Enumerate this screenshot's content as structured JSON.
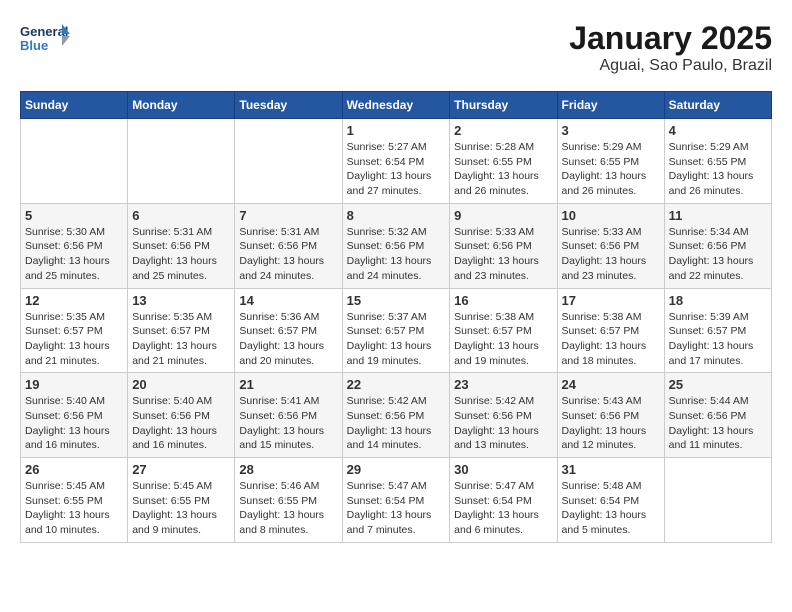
{
  "header": {
    "logo_line1": "General",
    "logo_line2": "Blue",
    "month": "January 2025",
    "location": "Aguai, Sao Paulo, Brazil"
  },
  "weekdays": [
    "Sunday",
    "Monday",
    "Tuesday",
    "Wednesday",
    "Thursday",
    "Friday",
    "Saturday"
  ],
  "weeks": [
    [
      {
        "day": "",
        "info": ""
      },
      {
        "day": "",
        "info": ""
      },
      {
        "day": "",
        "info": ""
      },
      {
        "day": "1",
        "info": "Sunrise: 5:27 AM\nSunset: 6:54 PM\nDaylight: 13 hours\nand 27 minutes."
      },
      {
        "day": "2",
        "info": "Sunrise: 5:28 AM\nSunset: 6:55 PM\nDaylight: 13 hours\nand 26 minutes."
      },
      {
        "day": "3",
        "info": "Sunrise: 5:29 AM\nSunset: 6:55 PM\nDaylight: 13 hours\nand 26 minutes."
      },
      {
        "day": "4",
        "info": "Sunrise: 5:29 AM\nSunset: 6:55 PM\nDaylight: 13 hours\nand 26 minutes."
      }
    ],
    [
      {
        "day": "5",
        "info": "Sunrise: 5:30 AM\nSunset: 6:56 PM\nDaylight: 13 hours\nand 25 minutes."
      },
      {
        "day": "6",
        "info": "Sunrise: 5:31 AM\nSunset: 6:56 PM\nDaylight: 13 hours\nand 25 minutes."
      },
      {
        "day": "7",
        "info": "Sunrise: 5:31 AM\nSunset: 6:56 PM\nDaylight: 13 hours\nand 24 minutes."
      },
      {
        "day": "8",
        "info": "Sunrise: 5:32 AM\nSunset: 6:56 PM\nDaylight: 13 hours\nand 24 minutes."
      },
      {
        "day": "9",
        "info": "Sunrise: 5:33 AM\nSunset: 6:56 PM\nDaylight: 13 hours\nand 23 minutes."
      },
      {
        "day": "10",
        "info": "Sunrise: 5:33 AM\nSunset: 6:56 PM\nDaylight: 13 hours\nand 23 minutes."
      },
      {
        "day": "11",
        "info": "Sunrise: 5:34 AM\nSunset: 6:56 PM\nDaylight: 13 hours\nand 22 minutes."
      }
    ],
    [
      {
        "day": "12",
        "info": "Sunrise: 5:35 AM\nSunset: 6:57 PM\nDaylight: 13 hours\nand 21 minutes."
      },
      {
        "day": "13",
        "info": "Sunrise: 5:35 AM\nSunset: 6:57 PM\nDaylight: 13 hours\nand 21 minutes."
      },
      {
        "day": "14",
        "info": "Sunrise: 5:36 AM\nSunset: 6:57 PM\nDaylight: 13 hours\nand 20 minutes."
      },
      {
        "day": "15",
        "info": "Sunrise: 5:37 AM\nSunset: 6:57 PM\nDaylight: 13 hours\nand 19 minutes."
      },
      {
        "day": "16",
        "info": "Sunrise: 5:38 AM\nSunset: 6:57 PM\nDaylight: 13 hours\nand 19 minutes."
      },
      {
        "day": "17",
        "info": "Sunrise: 5:38 AM\nSunset: 6:57 PM\nDaylight: 13 hours\nand 18 minutes."
      },
      {
        "day": "18",
        "info": "Sunrise: 5:39 AM\nSunset: 6:57 PM\nDaylight: 13 hours\nand 17 minutes."
      }
    ],
    [
      {
        "day": "19",
        "info": "Sunrise: 5:40 AM\nSunset: 6:56 PM\nDaylight: 13 hours\nand 16 minutes."
      },
      {
        "day": "20",
        "info": "Sunrise: 5:40 AM\nSunset: 6:56 PM\nDaylight: 13 hours\nand 16 minutes."
      },
      {
        "day": "21",
        "info": "Sunrise: 5:41 AM\nSunset: 6:56 PM\nDaylight: 13 hours\nand 15 minutes."
      },
      {
        "day": "22",
        "info": "Sunrise: 5:42 AM\nSunset: 6:56 PM\nDaylight: 13 hours\nand 14 minutes."
      },
      {
        "day": "23",
        "info": "Sunrise: 5:42 AM\nSunset: 6:56 PM\nDaylight: 13 hours\nand 13 minutes."
      },
      {
        "day": "24",
        "info": "Sunrise: 5:43 AM\nSunset: 6:56 PM\nDaylight: 13 hours\nand 12 minutes."
      },
      {
        "day": "25",
        "info": "Sunrise: 5:44 AM\nSunset: 6:56 PM\nDaylight: 13 hours\nand 11 minutes."
      }
    ],
    [
      {
        "day": "26",
        "info": "Sunrise: 5:45 AM\nSunset: 6:55 PM\nDaylight: 13 hours\nand 10 minutes."
      },
      {
        "day": "27",
        "info": "Sunrise: 5:45 AM\nSunset: 6:55 PM\nDaylight: 13 hours\nand 9 minutes."
      },
      {
        "day": "28",
        "info": "Sunrise: 5:46 AM\nSunset: 6:55 PM\nDaylight: 13 hours\nand 8 minutes."
      },
      {
        "day": "29",
        "info": "Sunrise: 5:47 AM\nSunset: 6:54 PM\nDaylight: 13 hours\nand 7 minutes."
      },
      {
        "day": "30",
        "info": "Sunrise: 5:47 AM\nSunset: 6:54 PM\nDaylight: 13 hours\nand 6 minutes."
      },
      {
        "day": "31",
        "info": "Sunrise: 5:48 AM\nSunset: 6:54 PM\nDaylight: 13 hours\nand 5 minutes."
      },
      {
        "day": "",
        "info": ""
      }
    ]
  ]
}
